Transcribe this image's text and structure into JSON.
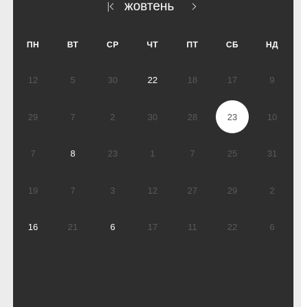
{
  "header": {
    "month": "жовтень"
  },
  "weekdays": [
    "ПН",
    "ВТ",
    "СР",
    "ЧТ",
    "ПТ",
    "СБ",
    "НД"
  ],
  "weeks": [
    [
      {
        "d": "12",
        "a": false
      },
      {
        "d": "5",
        "a": false
      },
      {
        "d": "30",
        "a": false
      },
      {
        "d": "22",
        "a": true
      },
      {
        "d": "18",
        "a": false
      },
      {
        "d": "17",
        "a": false
      },
      {
        "d": "9",
        "a": false
      }
    ],
    [
      {
        "d": "29",
        "a": false
      },
      {
        "d": "7",
        "a": false
      },
      {
        "d": "2",
        "a": false
      },
      {
        "d": "30",
        "a": false
      },
      {
        "d": "28",
        "a": false
      },
      {
        "d": "23",
        "a": false,
        "selected": true
      },
      {
        "d": "10",
        "a": false
      }
    ],
    [
      {
        "d": "7",
        "a": false
      },
      {
        "d": "8",
        "a": true
      },
      {
        "d": "23",
        "a": false
      },
      {
        "d": "1",
        "a": false
      },
      {
        "d": "7",
        "a": false
      },
      {
        "d": "25",
        "a": false
      },
      {
        "d": "31",
        "a": false
      }
    ],
    [
      {
        "d": "19",
        "a": false
      },
      {
        "d": "7",
        "a": false
      },
      {
        "d": "3",
        "a": false
      },
      {
        "d": "12",
        "a": false
      },
      {
        "d": "27",
        "a": false
      },
      {
        "d": "29",
        "a": false
      },
      {
        "d": "2",
        "a": false
      }
    ],
    [
      {
        "d": "16",
        "a": true
      },
      {
        "d": "21",
        "a": false
      },
      {
        "d": "6",
        "a": true
      },
      {
        "d": "17",
        "a": false
      },
      {
        "d": "11",
        "a": false
      },
      {
        "d": "22",
        "a": false
      },
      {
        "d": "6",
        "a": false
      }
    ]
  ],
  "colors": {
    "panel": "#2e2e2e",
    "active_day": "#ffffff",
    "muted_day": "#5a5a5a",
    "selected_bg": "#ffffff"
  }
}
